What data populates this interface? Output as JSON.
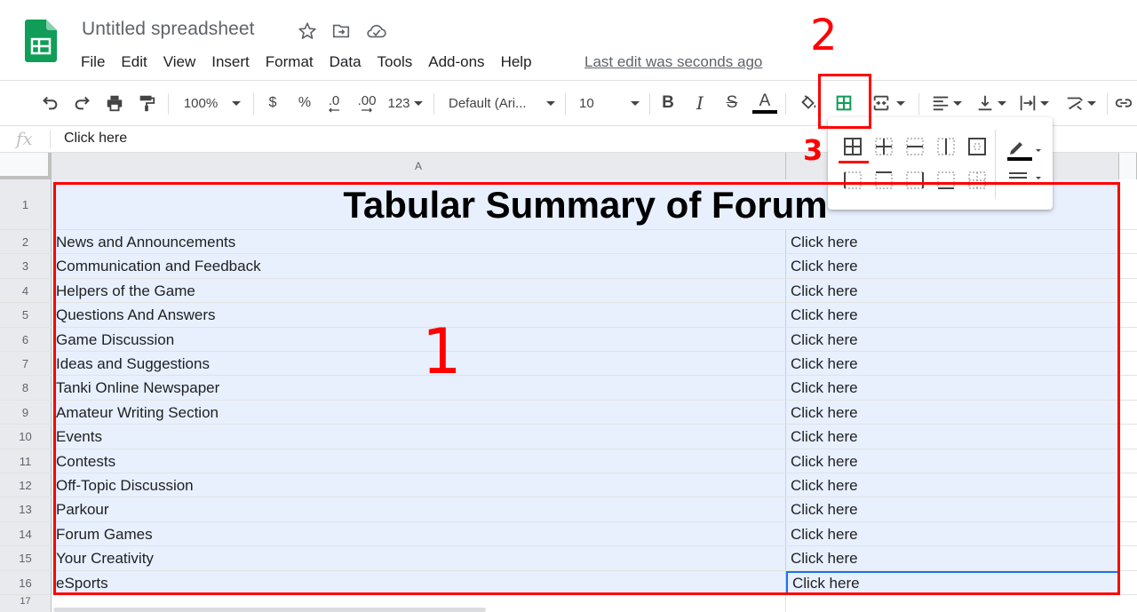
{
  "header": {
    "doc_title": "Untitled spreadsheet",
    "menu": [
      "File",
      "Edit",
      "View",
      "Insert",
      "Format",
      "Data",
      "Tools",
      "Add-ons",
      "Help"
    ],
    "last_edit": "Last edit was seconds ago",
    "logo_icon": "sheets-logo-icon",
    "star_icon": "star-icon",
    "move_icon": "folder-move-icon",
    "cloud_icon": "cloud-saved-icon"
  },
  "toolbar": {
    "zoom": "100%",
    "currency": "$",
    "percent": "%",
    "decrease_decimal": ".0",
    "increase_decimal": ".00",
    "more_formats": "123",
    "font": "Default (Ari...",
    "font_size": "10",
    "bold": "B",
    "italic": "I",
    "strike": "S",
    "text_color": "A"
  },
  "formula_bar": {
    "fx": "fx",
    "content": "Click here"
  },
  "sheet": {
    "column_a": "A",
    "title": "Tabular Summary of Forum",
    "rows": [
      {
        "num": "1",
        "a": "",
        "b": ""
      },
      {
        "num": "2",
        "a": "News and Announcements",
        "b": "Click here"
      },
      {
        "num": "3",
        "a": "Communication and Feedback",
        "b": "Click here"
      },
      {
        "num": "4",
        "a": "Helpers of the Game",
        "b": "Click here"
      },
      {
        "num": "5",
        "a": "Questions And Answers",
        "b": "Click here"
      },
      {
        "num": "6",
        "a": "Game Discussion",
        "b": "Click here"
      },
      {
        "num": "7",
        "a": "Ideas and Suggestions",
        "b": "Click here"
      },
      {
        "num": "8",
        "a": "Tanki Online Newspaper",
        "b": "Click here"
      },
      {
        "num": "9",
        "a": "Amateur Writing Section",
        "b": "Click here"
      },
      {
        "num": "10",
        "a": "Events",
        "b": "Click here"
      },
      {
        "num": "11",
        "a": "Contests",
        "b": "Click here"
      },
      {
        "num": "12",
        "a": "Off-Topic Discussion",
        "b": "Click here"
      },
      {
        "num": "13",
        "a": "Parkour",
        "b": "Click here"
      },
      {
        "num": "14",
        "a": "Forum Games",
        "b": "Click here"
      },
      {
        "num": "15",
        "a": "Your Creativity",
        "b": "Click here"
      },
      {
        "num": "16",
        "a": "eSports",
        "b": "Click here"
      },
      {
        "num": "17",
        "a": "",
        "b": ""
      }
    ]
  },
  "annotations": {
    "one": "1",
    "two": "2",
    "three": "3"
  },
  "colors": {
    "selection": "#e8f0fe",
    "accent": "#1a73e8",
    "annotation": "#ff0000",
    "sheets_green": "#0f9d58"
  }
}
